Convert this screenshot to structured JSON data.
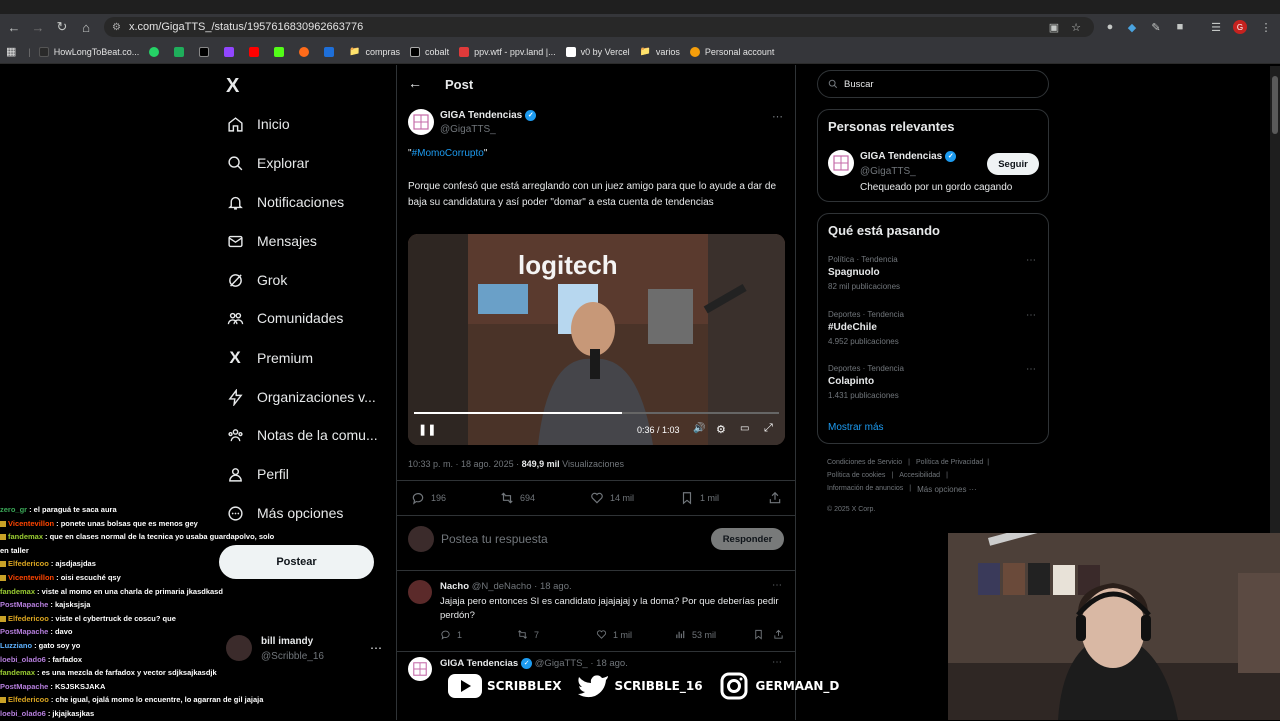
{
  "browser": {
    "url": "x.com/GigaTTS_/status/1957616830962663776",
    "bookmarks": [
      "HowLongToBeat.co...",
      "compras",
      "cobalt",
      "ppv.wtf - ppv.land |...",
      "v0 by Vercel",
      "varios",
      "Personal account"
    ],
    "profile_initial": "G",
    "colors": {
      "chrome_bg": "#35363a",
      "omnibox_bg": "#282828"
    }
  },
  "nav": {
    "logo": "X",
    "items": [
      {
        "label": "Inicio",
        "icon": "home-icon"
      },
      {
        "label": "Explorar",
        "icon": "search-icon"
      },
      {
        "label": "Notificaciones",
        "icon": "bell-icon"
      },
      {
        "label": "Mensajes",
        "icon": "mail-icon"
      },
      {
        "label": "Grok",
        "icon": "grok-icon"
      },
      {
        "label": "Comunidades",
        "icon": "people-icon"
      },
      {
        "label": "Premium",
        "icon": "x-icon"
      },
      {
        "label": "Organizaciones v...",
        "icon": "lightning-icon"
      },
      {
        "label": "Notas de la comu...",
        "icon": "community-notes-icon"
      },
      {
        "label": "Perfil",
        "icon": "person-icon"
      },
      {
        "label": "Más opciones",
        "icon": "more-circle-icon"
      }
    ],
    "post_button": "Postear",
    "account": {
      "name": "bill imandy",
      "handle": "@Scribble_16"
    }
  },
  "post": {
    "header_title": "Post",
    "author_name": "GIGA Tendencias",
    "author_handle": "@GigaTTS_",
    "hashtag_open": "\"",
    "hashtag": "#MomoCorrupto",
    "hashtag_close": "\"",
    "body": "Porque confesó que está arreglando con un juez amigo para que lo ayude a dar de baja su candidatura y así poder \"domar\" a esta cuenta de tendencias",
    "video": {
      "time": "0:36 / 1:03",
      "progress": 0.57
    },
    "timestamp": "10:33 p. m. · 18 ago. 2025 ·",
    "views_count": "849,9 mil",
    "views_label": "Visualizaciones",
    "stats": {
      "replies": "196",
      "reposts": "694",
      "likes": "14 mil",
      "bookmarks": "1 mil"
    },
    "reply_placeholder": "Postea tu respuesta",
    "reply_button": "Responder"
  },
  "replies": [
    {
      "name": "Nacho",
      "handle": "@N_deNacho · 18 ago.",
      "text": "Jajaja pero entonces SI es candidato jajajajaj y la doma? Por que deberías pedir perdón?",
      "stats": {
        "replies": "1",
        "reposts": "7",
        "likes": "1 mil",
        "views": "53 mil"
      }
    },
    {
      "name": "GIGA Tendencias",
      "handle": "@GigaTTS_ · 18 ago."
    }
  ],
  "right": {
    "search_placeholder": "Buscar",
    "relevant_title": "Personas relevantes",
    "relevant_person": {
      "name": "GIGA Tendencias",
      "handle": "@GigaTTS_",
      "follow": "Seguir",
      "bio": "Chequeado por un gordo cagando"
    },
    "trending_title": "Qué está pasando",
    "trends": [
      {
        "category": "Política · Tendencia",
        "name": "Spagnuolo",
        "count": "82 mil publicaciones"
      },
      {
        "category": "Deportes · Tendencia",
        "name": "#UdeChile",
        "count": "4.952 publicaciones"
      },
      {
        "category": "Deportes · Tendencia",
        "name": "Colapinto",
        "count": "1.431 publicaciones"
      }
    ],
    "show_more": "Mostrar más",
    "footer": {
      "terms": "Condiciones de Servicio",
      "privacy": "Política de Privacidad",
      "cookies": "Política de cookies",
      "accessibility": "Accesibilidad",
      "ads": "Información de anuncios",
      "more": "Más opciones ···",
      "copyright": "© 2025 X Corp."
    }
  },
  "chat": [
    {
      "user": "zero_gr",
      "msg": ": el paraguá te saca aura",
      "color": "#3aa757",
      "badge": false
    },
    {
      "user": "Vicentevillon",
      "msg": ": ponete unas bolsas que es menos gey",
      "color": "#ff4500",
      "badge": true
    },
    {
      "user": "fandemax",
      "msg": ": que en clases normal de la tecnica yo  usaba guardapolvo, solo",
      "color": "#9acd32",
      "badge": true
    },
    {
      "user": "",
      "msg": "en taller",
      "color": "#fff",
      "badge": false
    },
    {
      "user": "Elfedericoo",
      "msg": ": ajsdjasjdas",
      "color": "#daa520",
      "badge": true
    },
    {
      "user": "Vicentevillon",
      "msg": ": oisi escuché qsy",
      "color": "#ff4500",
      "badge": true
    },
    {
      "user": "fandemax",
      "msg": ": viste al momo en una charla de primaria jkasdkasd",
      "color": "#9acd32",
      "badge": false
    },
    {
      "user": "PostMapache",
      "msg": ": kajsksjsja",
      "color": "#b57edc",
      "badge": false
    },
    {
      "user": "Elfedericoo",
      "msg": ": viste el cybertruck de coscu? que",
      "color": "#daa520",
      "badge": true
    },
    {
      "user": "PostMapache",
      "msg": ": davo",
      "color": "#b57edc",
      "badge": false
    },
    {
      "user": "Luzziano",
      "msg": ": gato soy yo",
      "color": "#5fb3ff",
      "badge": false
    },
    {
      "user": "loebi_olado6",
      "msg": ": farfadox",
      "color": "#b57edc",
      "badge": false
    },
    {
      "user": "fandemax",
      "msg": ": es una mezcla de farfadox y vector sdjksajkasdjk",
      "color": "#9acd32",
      "badge": false
    },
    {
      "user": "PostMapache",
      "msg": ": KSJSKSJAKA",
      "color": "#b57edc",
      "badge": false
    },
    {
      "user": "Elfedericoo",
      "msg": ": che igual, ojalá momo lo encuentre, lo agarran de gil jajaja",
      "color": "#daa520",
      "badge": true
    },
    {
      "user": "loebi_olado6",
      "msg": ": jkjajkasjkas",
      "color": "#b57edc",
      "badge": false
    }
  ],
  "social": [
    {
      "icon": "youtube-icon",
      "label": "SCRIBBLEX"
    },
    {
      "icon": "twitter-bird-icon",
      "label": "SCRIBBLE_16"
    },
    {
      "icon": "instagram-icon",
      "label": "GERMAAN_D"
    }
  ]
}
